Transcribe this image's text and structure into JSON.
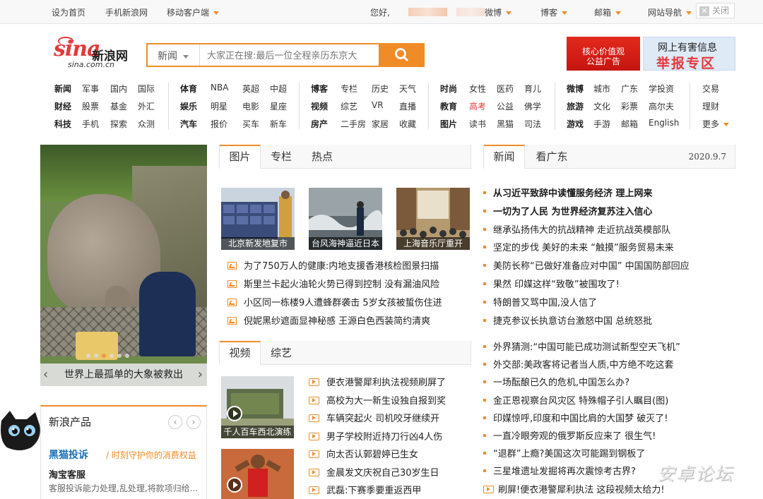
{
  "topbar": {
    "set_home": "设为首页",
    "mobile_site": "手机新浪网",
    "mobile_client": "移动客户端",
    "greeting": "您好,",
    "weibo": "微博",
    "blog": "博客",
    "mail": "邮箱",
    "site_nav": "网站导航",
    "close": "关闭"
  },
  "logo": {
    "brand": "sina",
    "cn": "新浪网",
    "url": "sina.com.cn"
  },
  "search": {
    "category": "新闻",
    "placeholder": "大家正在搜:最后一位全程亲历东京大"
  },
  "ads": {
    "ad1_line1": "核心价值观",
    "ad1_line2": "公益广告",
    "ad2_line1": "网上有害信息",
    "ad2_line2": "举报专区"
  },
  "nav": {
    "g1": [
      [
        "新闻",
        "军事",
        "国内",
        "国际"
      ],
      [
        "财经",
        "股票",
        "基金",
        "外汇"
      ],
      [
        "科技",
        "手机",
        "探索",
        "众测"
      ]
    ],
    "g2": [
      [
        "体育",
        "NBA",
        "英超",
        "中超"
      ],
      [
        "娱乐",
        "明星",
        "电影",
        "星座"
      ],
      [
        "汽车",
        "报价",
        "买车",
        "新车"
      ]
    ],
    "g3": [
      [
        "博客",
        "专栏",
        "历史",
        "天气"
      ],
      [
        "视频",
        "综艺",
        "VR",
        "直播"
      ],
      [
        "房产",
        "二手房",
        "家居",
        "收藏"
      ]
    ],
    "g4": [
      [
        "时尚",
        "女性",
        "医药",
        "育儿"
      ],
      [
        "教育",
        "高考",
        "公益",
        "佛学"
      ],
      [
        "图片",
        "读书",
        "黑猫",
        "司法"
      ]
    ],
    "g5": [
      [
        "微博",
        "城市",
        "广东",
        "学投资"
      ],
      [
        "旅游",
        "文化",
        "彩票",
        "高尔夫"
      ],
      [
        "游戏",
        "手游",
        "邮箱",
        "English"
      ]
    ],
    "g6": [
      "交易",
      "理财",
      "更多"
    ]
  },
  "hero": {
    "caption": "世界上最孤单的大象被救出"
  },
  "products": {
    "title": "新浪产品",
    "heimao": "黑猫投诉",
    "heimao_sub": "/ 时刻守护你的消费权益",
    "taobao": "淘宝客服",
    "taobao_desc": "客服投诉能力处理,乱处理,将款项归给..."
  },
  "pic_tabs": [
    "图片",
    "专栏",
    "热点"
  ],
  "pic_thumbs": [
    "北京新发地复市",
    "台风海神逼近日本",
    "上海音乐厅重开"
  ],
  "pic_news": [
    "为了750万人的健康:内地支援香港核检图景扫描",
    "斯里兰卡起火油轮火势已得到控制 没有漏油风险",
    "小区同一栋楼9人遭蜂群袭击 5岁女孩被蜇伤住进",
    "倪妮黑纱遮面显神秘感 王源白色西装简约清爽"
  ],
  "video_tabs": [
    "视频",
    "综艺"
  ],
  "video_thumbs": [
    "千人百车西北演练",
    ""
  ],
  "video_news": [
    "便衣港警犀利执法视频刷屏了",
    "高校为大一新生设独自报到奖",
    "车辆突起火 司机咬牙继续开",
    "男子学校附近持刀行凶4人伤",
    "向太否认郭碧婷已生女",
    "金晨发文庆祝自己30岁生日",
    "武磊:下赛季要重返西甲"
  ],
  "right_tabs": {
    "t1": "新闻",
    "t2": "看广东",
    "date": "2020.9.7"
  },
  "right_news": [
    {
      "t": "从习近平致辞中读懂服务经济 理上网来",
      "b": true
    },
    {
      "t": "一切为了人民 为世界经济复苏注入信心",
      "b": true
    },
    {
      "t": "继承弘扬伟大的抗战精神 走近抗战英模部队",
      "b": false
    },
    {
      "t": "坚定的步伐 美好的未来 “触摸”服务贸易未来",
      "b": false
    },
    {
      "t": "美防长称“已做好准备应对中国” 中国国防部回应",
      "b": false
    },
    {
      "t": "果然 印媒这样“致敬”被围攻了!",
      "b": false
    },
    {
      "t": "特朗普又骂中国,没人信了",
      "b": false
    },
    {
      "t": "捷克参议长执意访台激怒中国 总统怒批",
      "b": false
    }
  ],
  "right_news2": [
    "外界猜测:“中国可能已成功测试新型空天飞机”",
    "外交部:美政客将记者当人质,中方绝不吃这套",
    "一场酝酿已久的危机,中国怎么办?",
    "金正恩视察台风灾区 特殊帽子引人瞩目(图)",
    "印媒惊呼,印度和中国比肩的大国梦 破灭了!",
    "一直冷眼旁观的俄罗斯反应来了 很生气!",
    "“退群”上瘾?美国这次可能踢到钢板了",
    "三星堆遗址发掘将再次震惊考古界?",
    "刷屏!便衣港警犀利执法 这段视频太给力!"
  ],
  "watermark": "安卓论坛",
  "colors": {
    "accent": "#f08c28",
    "brand": "#e4393c",
    "link_blue": "#1b6eb8"
  }
}
